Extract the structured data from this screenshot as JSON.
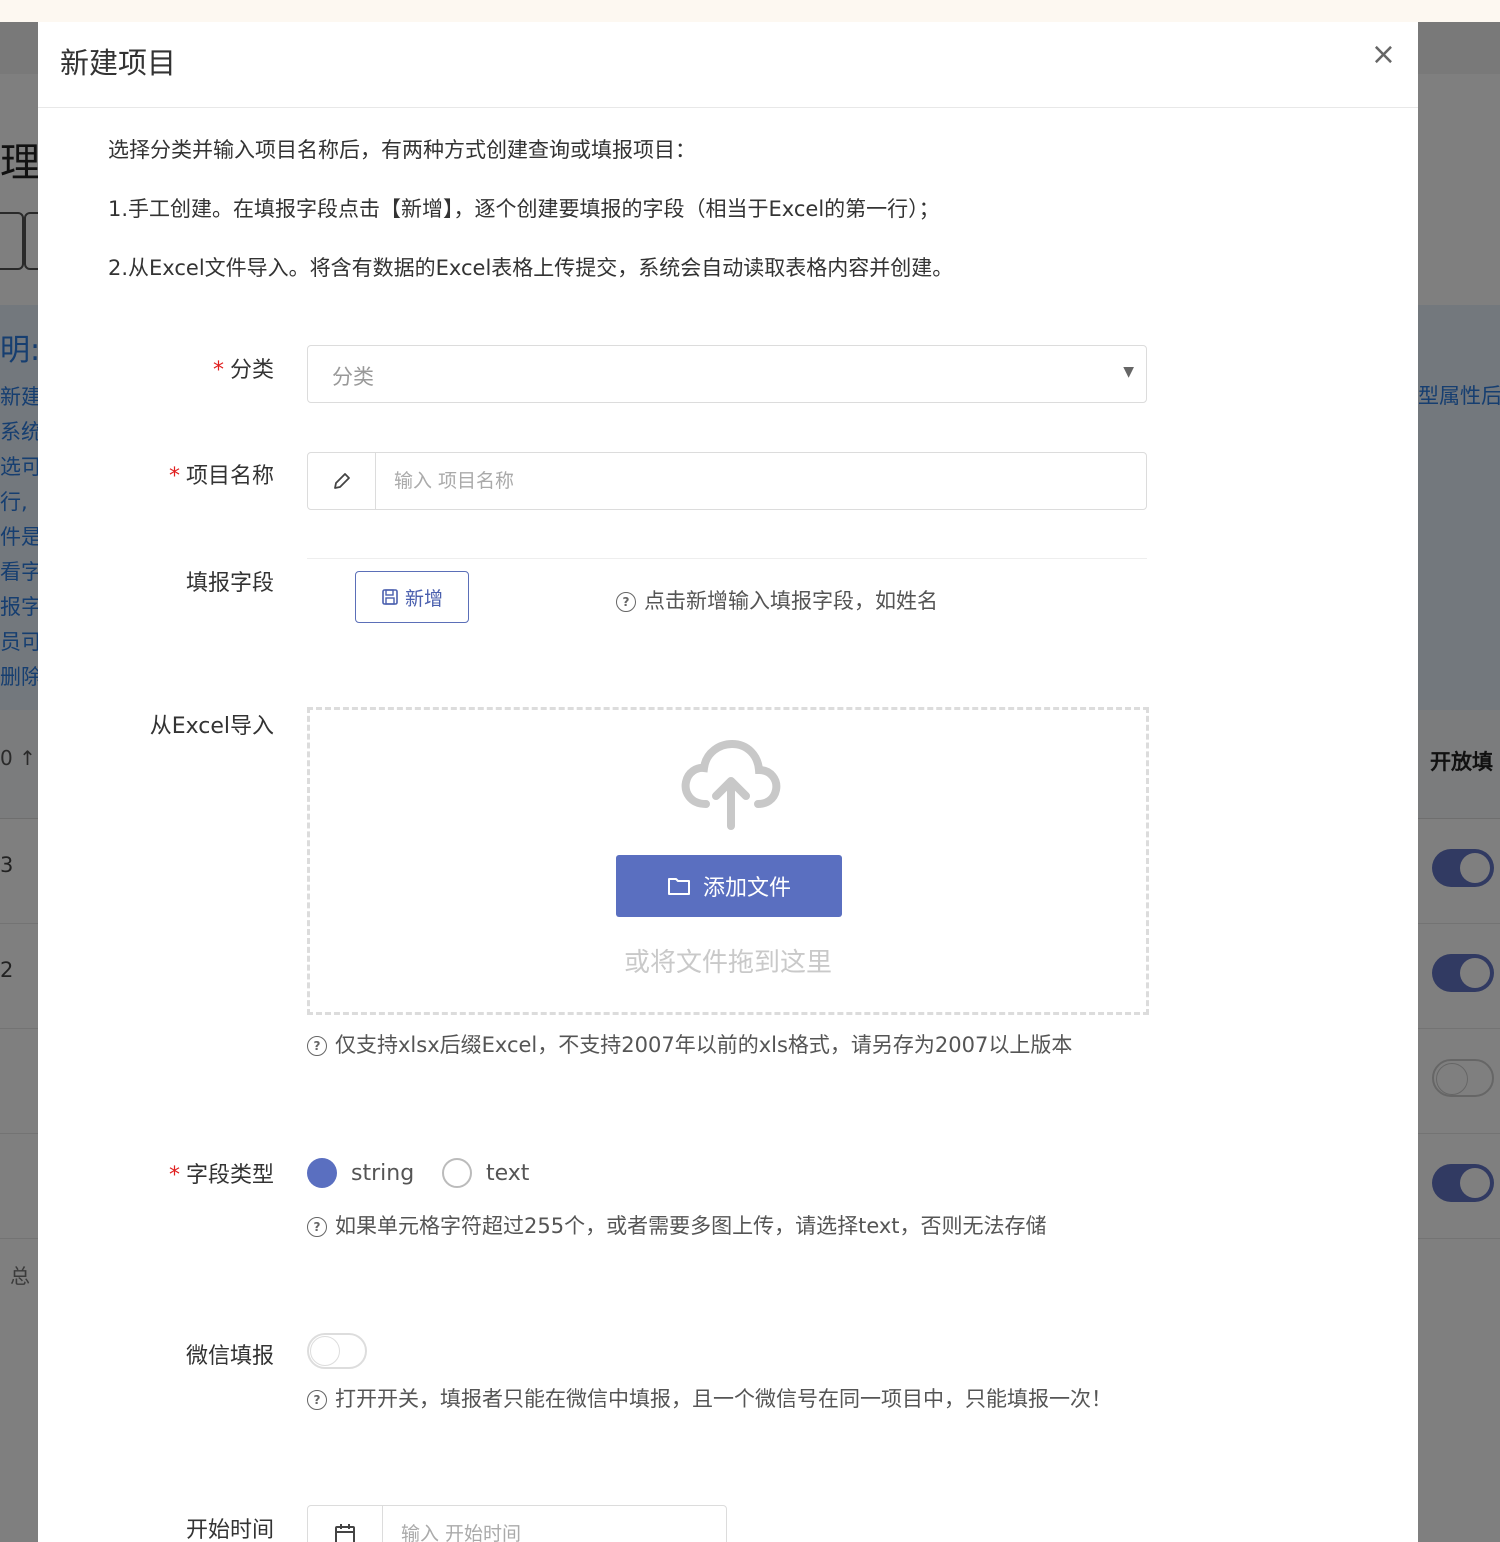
{
  "background": {
    "title_fragment": "理",
    "note_heading": "明:",
    "note_lines": [
      "新建",
      "系统",
      "选可",
      "行,",
      "件是",
      "看字",
      "报字",
      "员可",
      "删除"
    ],
    "note_right": "型属性后",
    "sort_indicator": "0 ↑",
    "column_right": "开放填",
    "rows": [
      {
        "num": "3",
        "toggle": "on"
      },
      {
        "num": "2",
        "toggle": "on"
      },
      {
        "num": "",
        "toggle": "off"
      },
      {
        "num": "",
        "toggle": "on"
      }
    ],
    "footer": "总"
  },
  "modal": {
    "title": "新建项目",
    "close": "×",
    "intro": [
      "选择分类并输入项目名称后，有两种方式创建查询或填报项目：",
      "1.手工创建。在填报字段点击【新增】，逐个创建要填报的字段（相当于Excel的第一行）；",
      "2.从Excel文件导入。将含有数据的Excel表格上传提交，系统会自动读取表格内容并创建。"
    ]
  },
  "form": {
    "category": {
      "label": "分类",
      "value": "分类",
      "required": true
    },
    "project_name": {
      "label": "项目名称",
      "placeholder": "输入 项目名称",
      "required": true
    },
    "fields": {
      "label": "填报字段",
      "add_button": "新增",
      "hint": "点击新增输入填报字段，如姓名"
    },
    "excel_import": {
      "label": "从Excel导入",
      "add_file_button": "添加文件",
      "drop_text": "或将文件拖到这里",
      "hint": "仅支持xlsx后缀Excel，不支持2007年以前的xls格式，请另存为2007以上版本"
    },
    "field_type": {
      "label": "字段类型",
      "required": true,
      "options": [
        "string",
        "text"
      ],
      "selected": "string",
      "hint": "如果单元格字符超过255个，或者需要多图上传，请选择text，否则无法存储"
    },
    "wechat": {
      "label": "微信填报",
      "enabled": false,
      "hint": "打开开关，填报者只能在微信中填报，且一个微信号在同一项目中，只能填报一次！"
    },
    "start_time": {
      "label": "开始时间",
      "placeholder": "输入 开始时间"
    }
  },
  "colors": {
    "primary": "#5a6fc0",
    "required": "#e02020",
    "overlay": "rgba(0,0,0,0.5)"
  },
  "icons": {
    "close": "close-icon",
    "caret": "chevron-down-icon",
    "name_addon": "pencil-icon",
    "add_field": "save-icon",
    "upload": "cloud-upload-icon",
    "add_file": "folder-icon",
    "hint": "question-circle-icon",
    "start_addon": "calendar-icon"
  }
}
